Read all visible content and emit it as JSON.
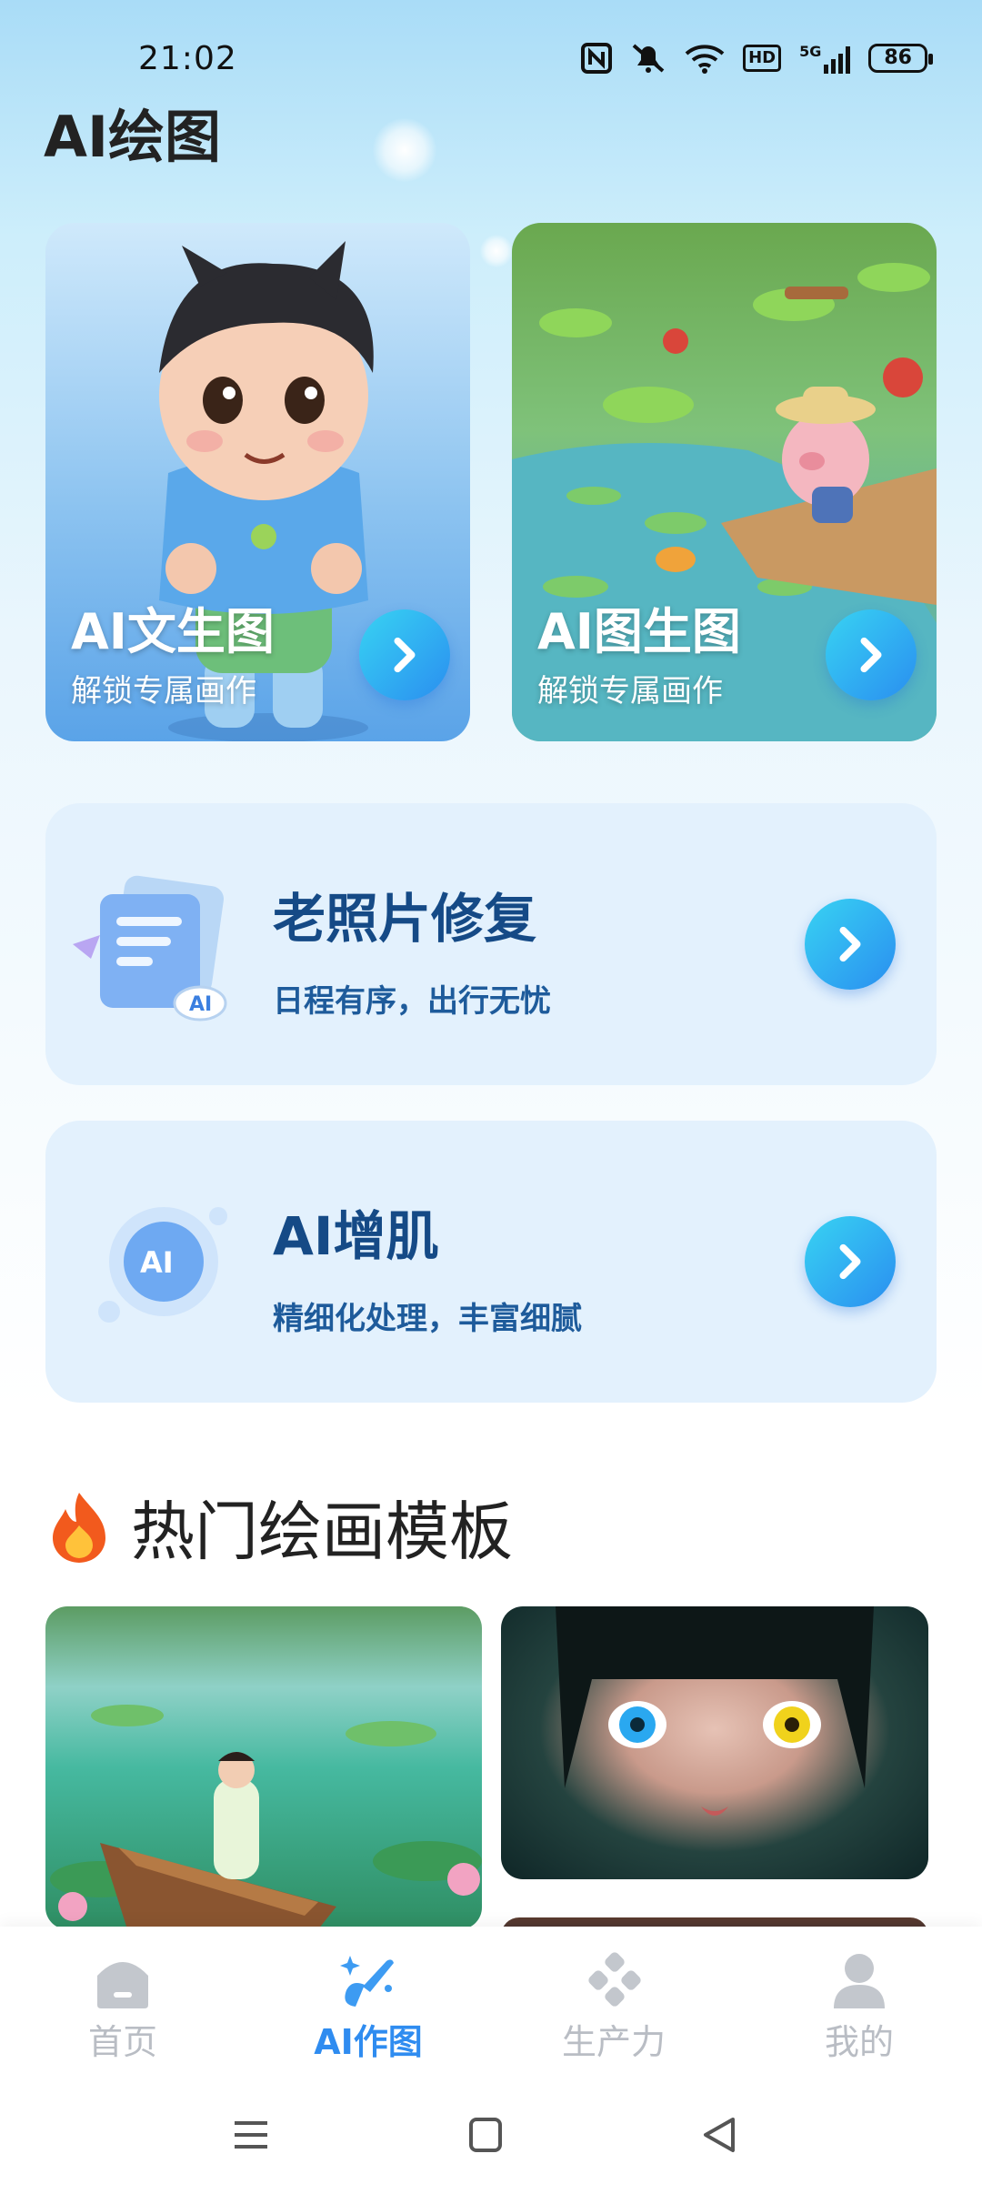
{
  "status_bar": {
    "time": "21:02",
    "battery": "86",
    "network": "5G",
    "hd": "HD"
  },
  "page": {
    "title": "AI绘图"
  },
  "feature_cards": [
    {
      "title": "AI文生图",
      "subtitle": "解锁专属画作"
    },
    {
      "title": "AI图生图",
      "subtitle": "解锁专属画作"
    }
  ],
  "tool_cards": [
    {
      "title": "老照片修复",
      "subtitle": "日程有序，出行无忧",
      "badge": "AI"
    },
    {
      "title": "AI增肌",
      "subtitle": "精细化处理，丰富细腻",
      "badge": "AI"
    }
  ],
  "hot_section": {
    "title": "热门绘画模板"
  },
  "bottom_nav": [
    {
      "label": "首页",
      "active": false
    },
    {
      "label": "AI作图",
      "active": true
    },
    {
      "label": "生产力",
      "active": false
    },
    {
      "label": "我的",
      "active": false
    }
  ],
  "colors": {
    "accent": "#2f8cf0",
    "arrow_gradient_start": "#38d3f3",
    "arrow_gradient_end": "#2a8ef0",
    "tool_card_bg": "#e3f1fd",
    "tool_title": "#154a86"
  },
  "icons": [
    "nfc-icon",
    "mute-icon",
    "wifi-icon",
    "hd-icon",
    "signal-icon",
    "battery-icon",
    "chevron-right-icon",
    "fire-icon",
    "home-icon",
    "ai-draw-icon",
    "productivity-icon",
    "profile-icon",
    "menu-icon",
    "square-icon",
    "back-icon"
  ]
}
